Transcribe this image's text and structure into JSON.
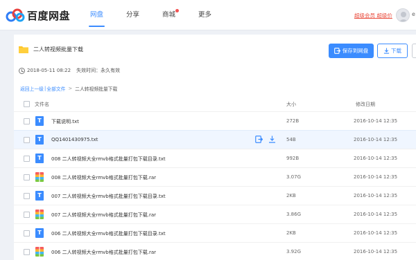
{
  "header": {
    "logo_text": "百度网盘",
    "nav": [
      {
        "label": "网盘",
        "active": true
      },
      {
        "label": "分享",
        "active": false
      },
      {
        "label": "商城",
        "active": false,
        "badge": true
      },
      {
        "label": "更多",
        "active": false
      }
    ],
    "vip_link": "超级会员 超级价",
    "user_initial": "e"
  },
  "share": {
    "title": "二人转视频批量下载",
    "created": "2018-05-11 08:22",
    "expiry": "失效时间：永久有效",
    "save_button": "保存到网盘",
    "download_button": "下载"
  },
  "breadcrumb": {
    "back": "返回上一级",
    "all_files": "全部文件",
    "current": "二人转视频批量下载"
  },
  "table": {
    "col_name": "文件名",
    "col_size": "大小",
    "col_date": "修改日期",
    "rows": [
      {
        "icon": "txt",
        "name": "下载说明.txt",
        "size": "272B",
        "date": "2016-10-14 12:35"
      },
      {
        "icon": "txt",
        "name": "QQ1401430975.txt",
        "size": "54B",
        "date": "2016-10-14 12:35",
        "hover": true
      },
      {
        "icon": "txt",
        "name": "008 二人转视频大全rmvb格式批量打包下载目录.txt",
        "size": "992B",
        "date": "2016-10-14 12:35"
      },
      {
        "icon": "rar",
        "name": "008 二人转视频大全rmvb格式批量打包下载.rar",
        "size": "3.07G",
        "date": "2016-10-14 12:35"
      },
      {
        "icon": "txt",
        "name": "007 二人转视频大全rmvb格式批量打包下载目录.txt",
        "size": "2KB",
        "date": "2016-10-14 12:35"
      },
      {
        "icon": "rar",
        "name": "007 二人转视频大全rmvb格式批量打包下载.rar",
        "size": "3.86G",
        "date": "2016-10-14 12:35"
      },
      {
        "icon": "txt",
        "name": "006 二人转视频大全rmvb格式批量打包下载目录.txt",
        "size": "2KB",
        "date": "2016-10-14 12:35"
      },
      {
        "icon": "rar",
        "name": "006 二人转视频大全rmvb格式批量打包下载.rar",
        "size": "3.92G",
        "date": "2016-10-14 12:35"
      }
    ]
  },
  "colors": {
    "accent": "#3b8cff",
    "vip_red": "#e94a3b",
    "folder": "#ffc425"
  }
}
